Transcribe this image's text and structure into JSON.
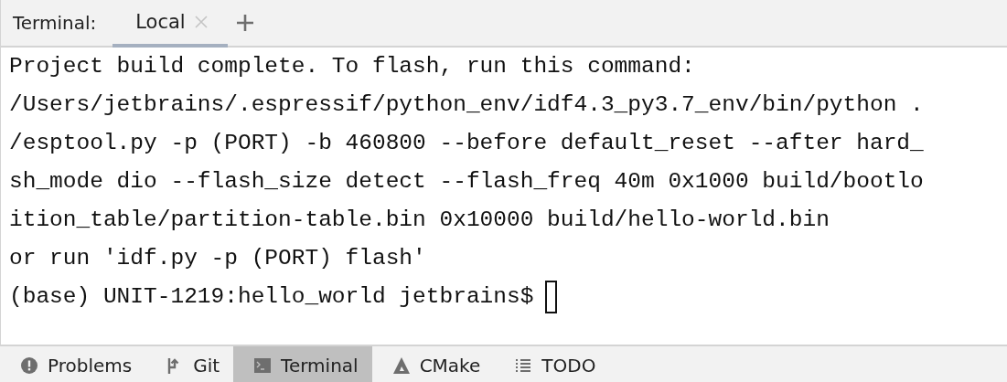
{
  "terminal_tabs": {
    "label": "Terminal:",
    "tabs": [
      {
        "label": "Local",
        "selected": true,
        "closable": true
      }
    ]
  },
  "output_lines": [
    "Project build complete. To flash, run this command:",
    "/Users/jetbrains/.espressif/python_env/idf4.3_py3.7_env/bin/python .",
    "/esptool.py -p (PORT) -b 460800 --before default_reset --after hard_",
    "sh_mode dio --flash_size detect --flash_freq 40m 0x1000 build/bootlo",
    "ition_table/partition-table.bin 0x10000 build/hello-world.bin",
    "or run 'idf.py -p (PORT) flash'"
  ],
  "prompt": "(base) UNIT-1219:hello_world jetbrains$",
  "tool_windows": [
    {
      "label": "Problems",
      "kind": "problems",
      "selected": false
    },
    {
      "label": "Git",
      "kind": "git",
      "selected": false
    },
    {
      "label": "Terminal",
      "kind": "terminal",
      "selected": true
    },
    {
      "label": "CMake",
      "kind": "cmake",
      "selected": false
    },
    {
      "label": "TODO",
      "kind": "todo",
      "selected": false
    }
  ]
}
